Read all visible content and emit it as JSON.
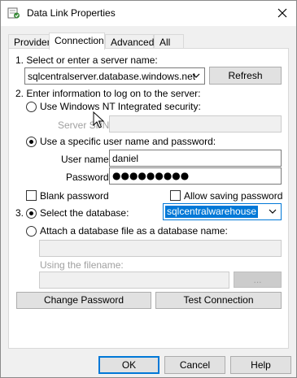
{
  "window": {
    "title": "Data Link Properties",
    "icon": "data-link-icon"
  },
  "tabs": [
    {
      "label": "Provider",
      "active": false
    },
    {
      "label": "Connection",
      "active": true
    },
    {
      "label": "Advanced",
      "active": false
    },
    {
      "label": "All",
      "active": false
    }
  ],
  "step1": {
    "label": "1. Select or enter a server name:",
    "server_value": "sqlcentralserver.database.windows.net",
    "refresh_label": "Refresh"
  },
  "step2": {
    "label": "2. Enter information to log on to the server:",
    "nt_security_label": "Use Windows NT Integrated security:",
    "server_spn_label": "Server SPN:",
    "server_spn_value": "",
    "specific_user_label": "Use a specific user name and password:",
    "username_label": "User name:",
    "username_value": "daniel",
    "password_label": "Password:",
    "password_value": "●●●●●●●●●",
    "blank_password_label": "Blank password",
    "allow_saving_label": "Allow saving password"
  },
  "step3": {
    "number": "3.",
    "select_db_label": "Select the database:",
    "database_value": "sqlcentralwarehouse",
    "attach_label": "Attach a database file as a database name:",
    "attach_value": "",
    "filename_label": "Using the filename:",
    "filename_value": "",
    "browse_label": "..."
  },
  "actions": {
    "change_password": "Change Password",
    "test_connection": "Test Connection"
  },
  "footer": {
    "ok": "OK",
    "cancel": "Cancel",
    "help": "Help"
  },
  "state": {
    "auth_mode": "specific-user",
    "database_mode": "select",
    "blank_password": false,
    "allow_saving_password": false
  }
}
